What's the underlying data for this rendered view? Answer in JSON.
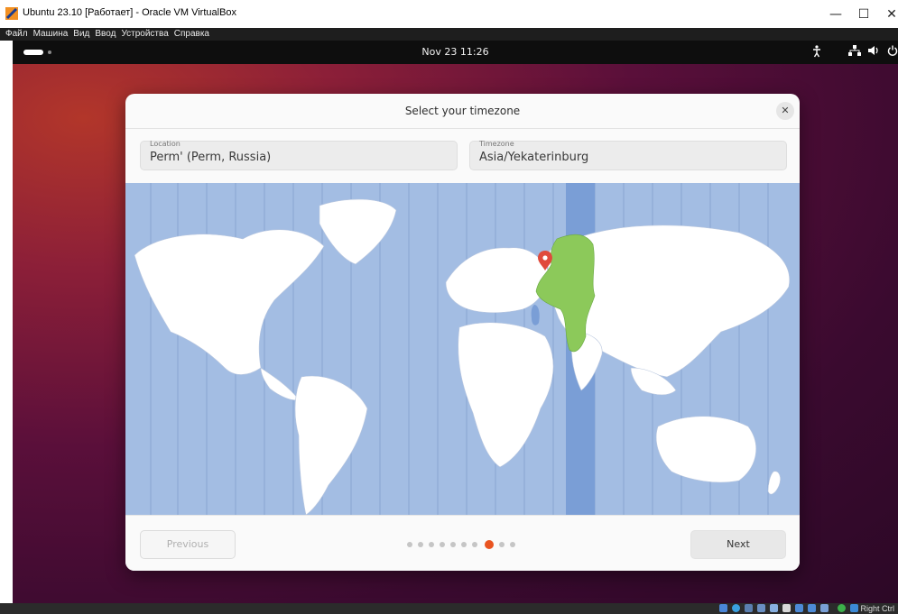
{
  "window": {
    "title": "Ubuntu 23.10 [Работает] - Oracle VM VirtualBox",
    "minimize": "—",
    "maximize": "☐",
    "close": "✕"
  },
  "vbox_menu": [
    "Файл",
    "Машина",
    "Вид",
    "Ввод",
    "Устройства",
    "Справка"
  ],
  "top_bar": {
    "clock": "Nov 23  11:26",
    "icons": [
      "accessibility-icon",
      "network-icon",
      "volume-icon",
      "power-icon"
    ]
  },
  "dialog": {
    "title": "Select your timezone",
    "close_symbol": "✕",
    "location": {
      "label": "Location",
      "value": "Perm' (Perm, Russia)"
    },
    "timezone": {
      "label": "Timezone",
      "value": "Asia/Yekaterinburg"
    },
    "map": {
      "selected_zone_color": "#8cc95a",
      "ocean_color": "#a3bde3",
      "highlight_band_color": "#7a9ed6",
      "pin_color": "#e04a3c"
    },
    "previous_label": "Previous",
    "next_label": "Next",
    "progress": {
      "total_steps": 10,
      "current_step": 8
    }
  },
  "host_taskbar": {
    "right_label": "Right Ctrl"
  },
  "colors": {
    "accent": "#e95420"
  }
}
